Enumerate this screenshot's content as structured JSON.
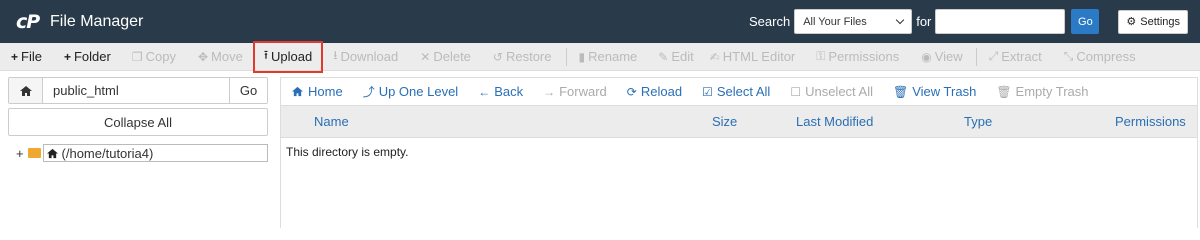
{
  "header": {
    "logo_text": "cP",
    "app_title": "File Manager",
    "search_label": "Search",
    "search_scope": "All Your Files",
    "for_label": "for",
    "search_value": "",
    "go_label": "Go",
    "settings_label": "Settings"
  },
  "toolbar": {
    "file": "File",
    "folder": "Folder",
    "copy": "Copy",
    "move": "Move",
    "upload": "Upload",
    "download": "Download",
    "delete": "Delete",
    "restore": "Restore",
    "rename": "Rename",
    "edit": "Edit",
    "html_editor": "HTML Editor",
    "permissions": "Permissions",
    "view": "View",
    "extract": "Extract",
    "compress": "Compress"
  },
  "left": {
    "path_value": "public_html",
    "go_label": "Go",
    "collapse_label": "Collapse All",
    "tree_root": "(/home/tutoria4)"
  },
  "nav": {
    "home": "Home",
    "up": "Up One Level",
    "back": "Back",
    "forward": "Forward",
    "reload": "Reload",
    "select_all": "Select All",
    "unselect_all": "Unselect All",
    "view_trash": "View Trash",
    "empty_trash": "Empty Trash"
  },
  "table": {
    "columns": [
      "Name",
      "Size",
      "Last Modified",
      "Type",
      "Permissions"
    ],
    "empty_message": "This directory is empty."
  },
  "colors": {
    "header_bg": "#293a4a",
    "accent": "#2a7ac5",
    "highlight": "#e03a2e"
  }
}
